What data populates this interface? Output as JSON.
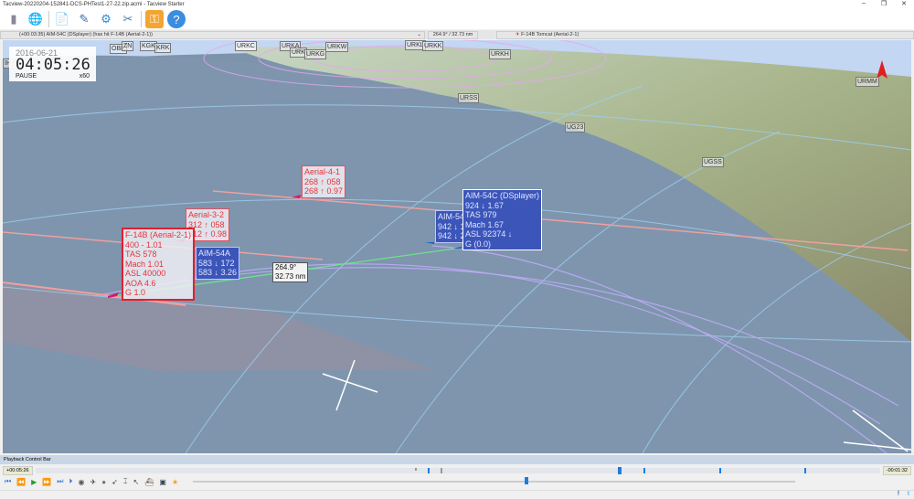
{
  "window": {
    "title": "Tacview-20220204-152841-DCS-PHTest1-27-22.zip.acmi - Tacview Starter",
    "minimize": "–",
    "restore": "❐",
    "close": "✕"
  },
  "toolbar": {
    "icons": [
      "usb-drive-icon",
      "globe-icon",
      "document-icon",
      "edit-icon",
      "gear-icon",
      "tools-icon",
      "key-icon",
      "help-icon"
    ]
  },
  "infobar": {
    "event": "(+00:03:35) AIM-54C (DSplayer) (has hit F-14B (Aerial-2-1))",
    "bearing": "264.9° / 32.73 nm",
    "target": "F-14B Tomcat (Aerial-2-1)"
  },
  "clock": {
    "date": "2016-06-21",
    "time": "04:05:26",
    "state": "PAUSE",
    "speed": "x60"
  },
  "airports": [
    "OBK",
    "ZN",
    "KGK",
    "KRK",
    "URKA",
    "URK",
    "URKG",
    "URKW",
    "URKL",
    "URKK",
    "URKH",
    "URSS",
    "UG23",
    "UGSS",
    "URMM",
    "URKC",
    "IH"
  ],
  "labels": {
    "f14b": [
      "F-14B (Aerial-2-1)",
      "400 - 1.01",
      "TAS 578",
      "Mach 1.01",
      "ASL 40000",
      "AOA 4.6",
      "G 1.0"
    ],
    "aerial32": [
      "Aerial-3-2",
      "312 ↑ 058",
      "312 ↑ 0.98"
    ],
    "aerial41": [
      "Aerial-4-1",
      "268 ↑ 058",
      "268 ↑ 0.97"
    ],
    "aim54a_1": [
      "AIM-54A",
      "583 ↓ 172",
      "583 ↓ 3.26"
    ],
    "aim54a_2": [
      "AIM-54A",
      "942 ↓ 13",
      "942 ↓ 2.2"
    ],
    "aim54c": [
      "AIM-54C (DSplayer)",
      "924 ↓ 1.67",
      "TAS 979",
      "Mach 1.67",
      "ASL 92374 ↓",
      "G (0.0)"
    ]
  },
  "measure": {
    "bearing": "264.9°",
    "distance": "32.73 nm"
  },
  "playback": {
    "title": "Playback Control Bar",
    "elapsed": "+00:05:26",
    "remaining": "-00:01:32",
    "progress": 0.77
  }
}
